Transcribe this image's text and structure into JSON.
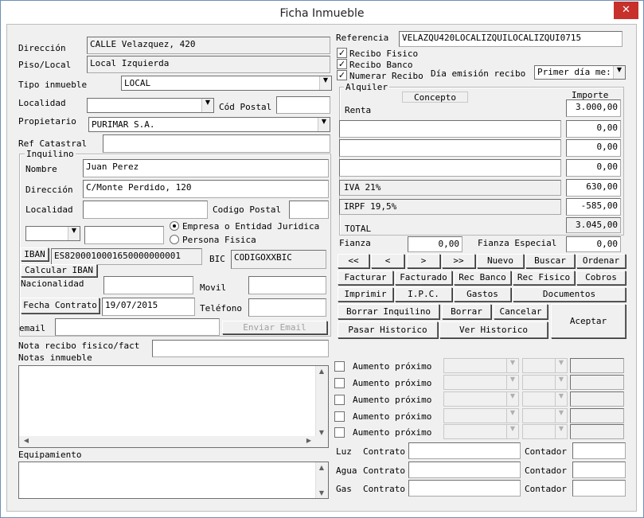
{
  "window": {
    "title": "Ficha Inmueble",
    "close_glyph": "✕"
  },
  "direccion": {
    "label": "Dirección",
    "value": "CALLE Velazquez, 420"
  },
  "piso": {
    "label": "Piso/Local",
    "value": "Local Izquierda"
  },
  "tipo": {
    "label": "Tipo inmueble",
    "value": "LOCAL"
  },
  "localidad": {
    "label": "Localidad",
    "value": ""
  },
  "cod_postal": {
    "label": "Cód Postal",
    "value": ""
  },
  "propietario": {
    "label": "Propietario",
    "value": "PURIMAR S.A."
  },
  "ref_catastral": {
    "label": "Ref Catastral",
    "value": ""
  },
  "inquilino": {
    "title": "Inquilino",
    "nombre_label": "Nombre",
    "nombre": "Juan Perez",
    "direccion_label": "Dirección",
    "direccion": "C/Monte Perdido, 120",
    "localidad_label": "Localidad",
    "localidad": "",
    "cp_label": "Codigo Postal",
    "cp": "",
    "doc_type": "",
    "doc_number": "",
    "radio_empresa": "Empresa o Entidad Juridica",
    "radio_persona": "Persona Fisica",
    "iban_button": "IBAN",
    "iban": "ES8200010001650000000001",
    "bic_label": "BIC",
    "bic": "CODIGOXXBIC",
    "calc_iban_button": "Calcular IBAN",
    "nacionalidad_label": "Nacionalidad",
    "nacionalidad": "",
    "movil_label": "Movil",
    "movil": "",
    "fecha_contrato_button": "Fecha Contrato",
    "fecha_contrato": "19/07/2015",
    "telefono_label": "Teléfono",
    "telefono": "",
    "email_label": "email",
    "email": "",
    "enviar_email": "Enviar Email"
  },
  "nota_recibo": {
    "label": "Nota recibo fisico/fact",
    "value": ""
  },
  "notas_label": "Notas inmueble",
  "equipamiento_label": "Equipamiento",
  "referencia": {
    "label": "Referencia",
    "value": "VELAZQU420LOCALIZQUILOCALIZQUI0715"
  },
  "checks": {
    "recibo_fisico": "Recibo Fisico",
    "recibo_banco": "Recibo Banco",
    "numerar_recibo": "Numerar Recibo",
    "check_glyph": "✓"
  },
  "dia_emision": {
    "label": "Día emisión recibo",
    "value": "Primer día me:"
  },
  "alquiler": {
    "title": "Alquiler",
    "concepto_header": "Concepto",
    "importe_header": "Importe",
    "renta_label": "Renta",
    "renta": "3.000,00",
    "extra_concepts": [
      "",
      "",
      ""
    ],
    "extra_values": [
      "0,00",
      "0,00",
      "0,00"
    ],
    "iva_label": "IVA 21%",
    "iva": "630,00",
    "irpf_label": "IRPF 19,5%",
    "irpf": "-585,00",
    "total_label": "TOTAL",
    "total": "3.045,00"
  },
  "fianza": {
    "label": "Fianza",
    "value": "0,00"
  },
  "fianza_especial": {
    "label": "Fianza Especial",
    "value": "0,00"
  },
  "nav": {
    "first": "<<",
    "prev": "<",
    "next": ">",
    "last": ">>",
    "nuevo": "Nuevo",
    "buscar": "Buscar",
    "ordenar": "Ordenar"
  },
  "actions": {
    "facturar": "Facturar",
    "facturado": "Facturado",
    "rec_banco": "Rec Banco",
    "rec_fisico": "Rec Fisico",
    "cobros": "Cobros",
    "imprimir": "Imprimir",
    "ipc": "I.P.C.",
    "gastos": "Gastos",
    "documentos": "Documentos",
    "borrar_inquilino": "Borrar Inquilino",
    "borrar": "Borrar",
    "cancelar": "Cancelar",
    "aceptar": "Aceptar",
    "pasar_historico": "Pasar Historico",
    "ver_historico": "Ver Historico"
  },
  "aumento_label": "Aumento próximo",
  "suministros": {
    "luz": "Luz",
    "agua": "Agua",
    "gas": "Gas",
    "contrato": "Contrato",
    "contador": "Contador"
  },
  "icons": {
    "dropdown": "▼",
    "scroll_up": "▲",
    "scroll_down": "▼",
    "scroll_left": "◀",
    "scroll_right": "▶"
  }
}
